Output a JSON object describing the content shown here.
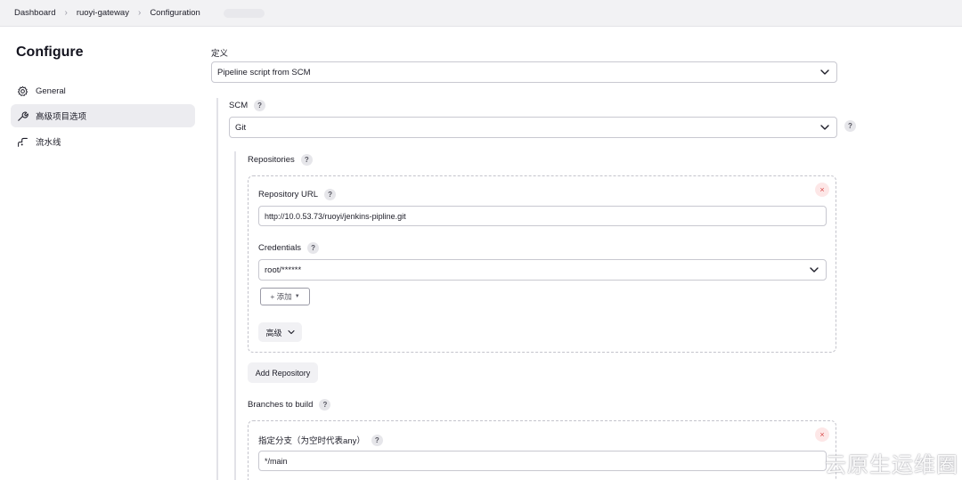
{
  "breadcrumb": [
    "Dashboard",
    "ruoyi-gateway",
    "Configuration"
  ],
  "sidebar": {
    "title": "Configure",
    "items": [
      {
        "label": "General",
        "icon": "gear-icon"
      },
      {
        "label": "高级项目选项",
        "icon": "wrench-icon"
      },
      {
        "label": "流水线",
        "icon": "pipeline-icon"
      }
    ]
  },
  "definition": {
    "label": "定义",
    "value": "Pipeline script from SCM"
  },
  "scm": {
    "label": "SCM",
    "help": "?",
    "value": "Git"
  },
  "repositories": {
    "label": "Repositories",
    "repository_url_label": "Repository URL",
    "repository_url_value": "http://10.0.53.73/ruoyi/jenkins-pipline.git",
    "credentials_label": "Credentials",
    "credentials_value": "root/******",
    "add_button": "+ 添加",
    "advanced_button": "高级",
    "add_repository_button": "Add Repository",
    "remove_symbol": "×"
  },
  "branches": {
    "label": "Branches to build",
    "specifier_label": "指定分支（为空时代表any）",
    "specifier_value": "*/main",
    "remove_symbol": "×"
  },
  "watermark": "云原生运维圈"
}
